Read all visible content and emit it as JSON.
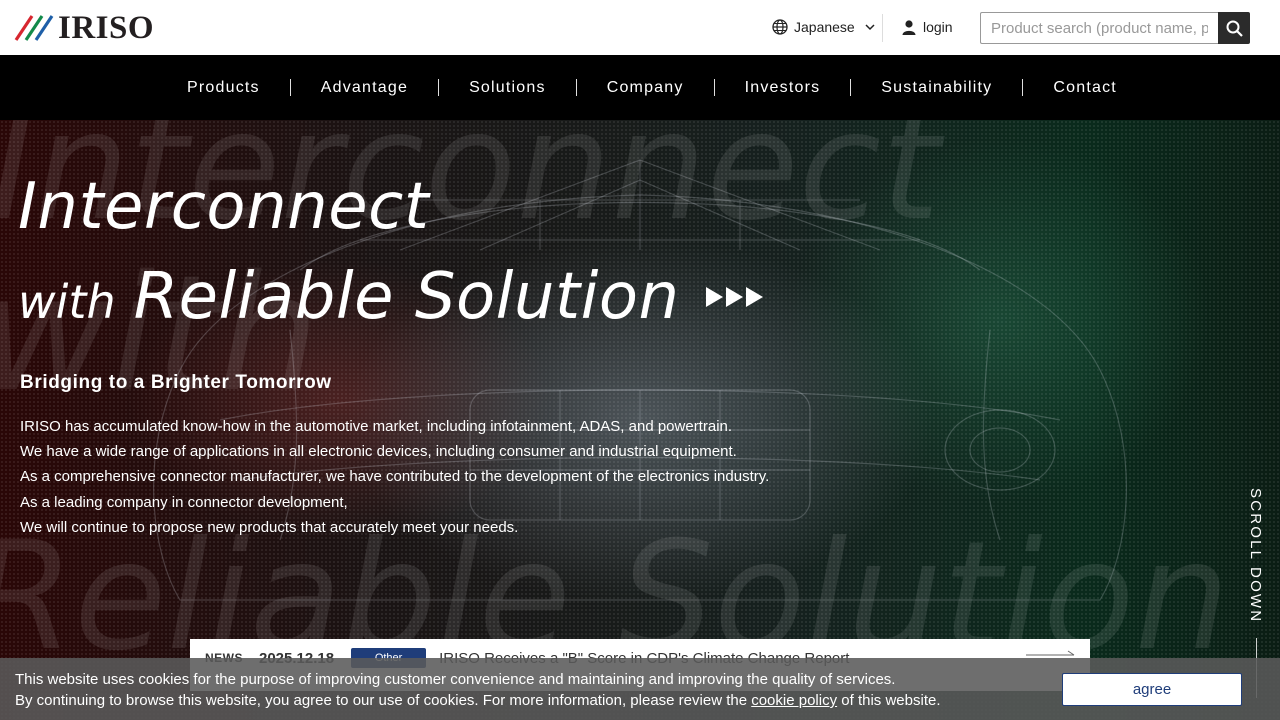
{
  "header": {
    "logo_text": "IRISO",
    "language": {
      "label": "Japanese",
      "icon": "globe-icon"
    },
    "login_label": "login",
    "search": {
      "placeholder": "Product search (product name, product"
    }
  },
  "nav": {
    "items": [
      "Products",
      "Advantage",
      "Solutions",
      "Company",
      "Investors",
      "Sustainability",
      "Contact"
    ]
  },
  "hero": {
    "background_words": [
      "Interconnect",
      "with",
      "Reliable Solution"
    ],
    "title_line1": "Interconnect",
    "title_line2_with": "with",
    "title_line2_main": "Reliable Solution",
    "tagline": "Bridging to a Brighter Tomorrow",
    "body_lines": [
      "IRISO has accumulated know-how in the automotive market, including infotainment, ADAS, and powertrain.",
      "We have a wide range of applications in all electronic devices, including consumer and industrial equipment.",
      "As a comprehensive connector manufacturer, we have contributed to the development of the electronics industry.",
      "As a leading company in connector development,",
      "We will continue to propose new products that accurately meet your needs."
    ],
    "scroll_label": "SCROLL DOWN"
  },
  "news": {
    "label": "NEWS",
    "date": "2025.12.18",
    "category": "Other",
    "title": "IRISO Receives a \"B\" Score in CDP's Climate Change Report"
  },
  "cookie": {
    "line1": "This website uses cookies for the purpose of improving customer convenience and maintaining and improving the quality of services.",
    "line2_before": "By continuing to browse this website, you agree to our use of cookies. For more information, please review the ",
    "link_text": "cookie policy",
    "line2_after": " of this website.",
    "agree_label": "agree"
  },
  "colors": {
    "brand_navy": "#1f3d7a",
    "logo_red": "#d7262f",
    "logo_green": "#138a4a",
    "logo_blue": "#1e5fa8"
  }
}
